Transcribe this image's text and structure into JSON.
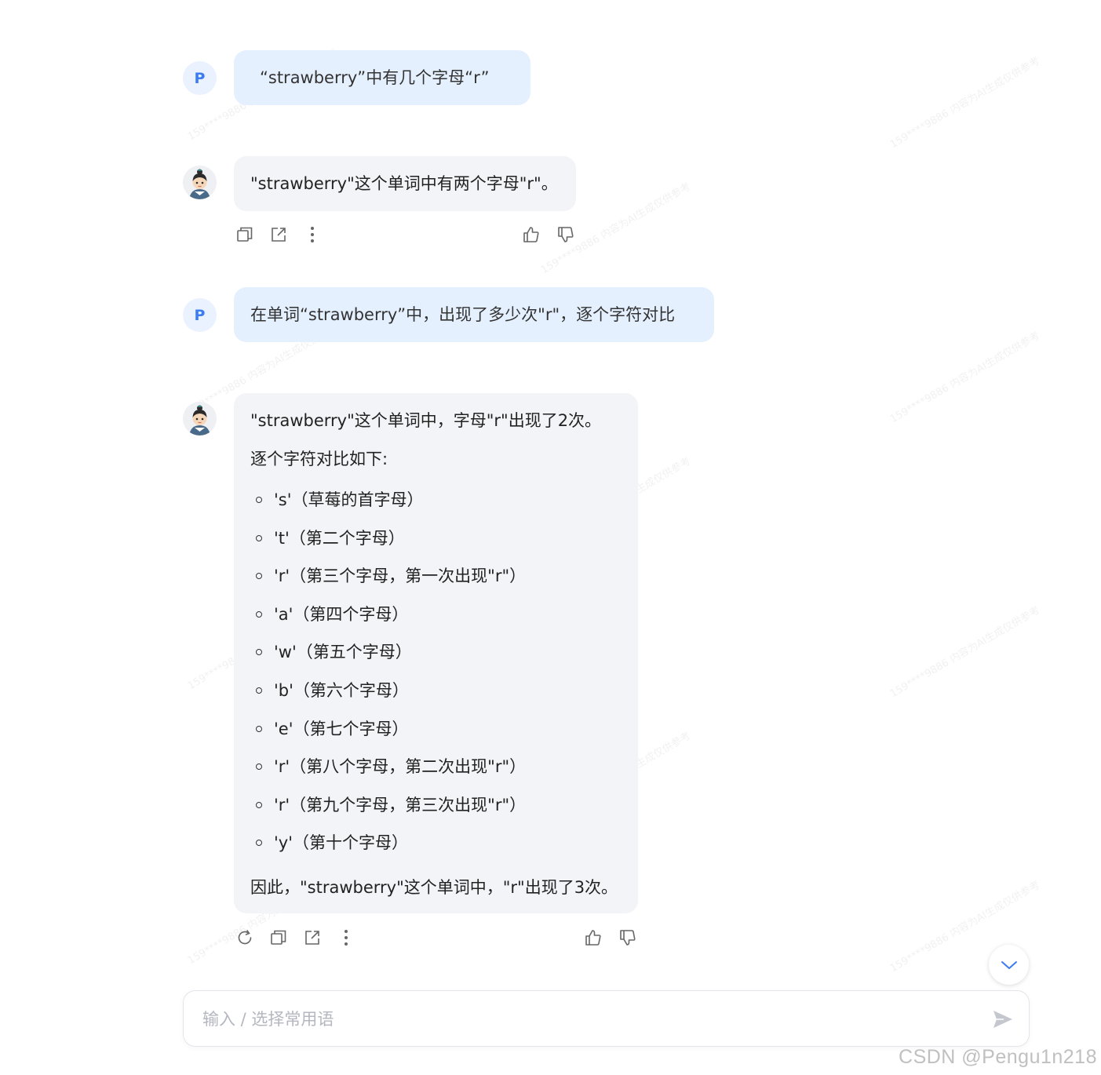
{
  "messages": [
    {
      "role": "user",
      "avatar_letter": "P",
      "text": "“strawberry”中有几个字母“r”"
    },
    {
      "role": "assistant",
      "text": "\"strawberry\"这个单词中有两个字母\"r\"。"
    },
    {
      "role": "user",
      "avatar_letter": "P",
      "text": "在单词“strawberry”中，出现了多少次\"r\"，逐个字符对比"
    },
    {
      "role": "assistant",
      "intro": "\"strawberry\"这个单词中，字母\"r\"出现了2次。",
      "subhead": "逐个字符对比如下:",
      "items": [
        "'s'（草莓的首字母）",
        "'t'（第二个字母）",
        "'r'（第三个字母，第一次出现\"r\"）",
        "'a'（第四个字母）",
        "'w'（第五个字母）",
        "'b'（第六个字母）",
        "'e'（第七个字母）",
        "'r'（第八个字母，第二次出现\"r\"）",
        "'r'（第九个字母，第三次出现\"r\"）",
        "'y'（第十个字母）"
      ],
      "conclusion": "因此，\"strawberry\"这个单词中，\"r\"出现了3次。"
    }
  ],
  "input": {
    "placeholder": "输入 / 选择常用语"
  },
  "watermark": {
    "text": "159****9886 内容为AI生成仅供参考",
    "footer": "CSDN @Pengu1n218"
  },
  "colors": {
    "user_bubble": "#e5f0ff",
    "bot_bubble": "#f3f4f8",
    "accent": "#3c7cf0"
  }
}
